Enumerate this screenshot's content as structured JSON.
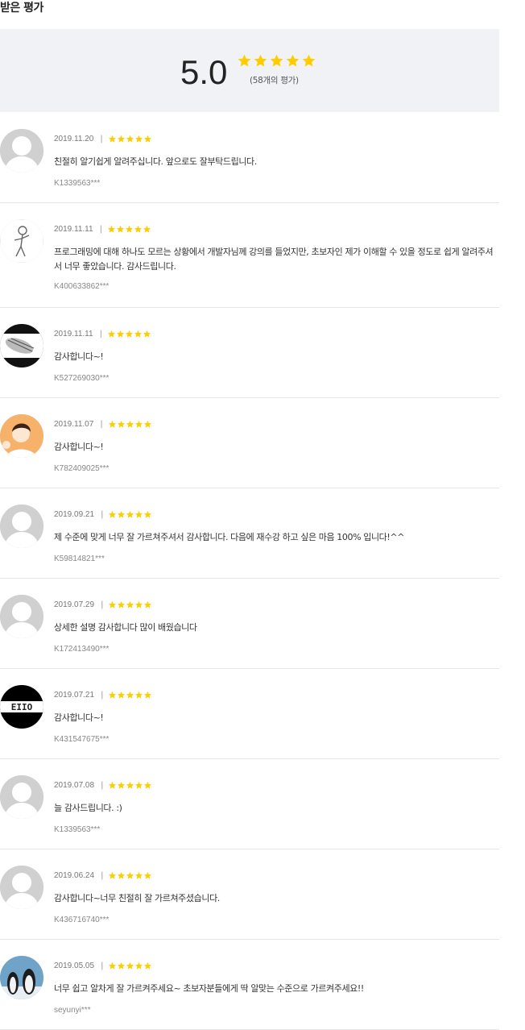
{
  "section_title": "받은 평가",
  "summary": {
    "score": "5.0",
    "stars": 5,
    "count_label": "(58개의 평가)"
  },
  "colors": {
    "star": "#ffcc00",
    "summary_bg": "#f1f2f6"
  },
  "reviews": [
    {
      "date": "2019.11.20",
      "rating": 5,
      "text": "친절히 알기쉽게 알려주십니다. 앞으로도 잘부탁드립니다.",
      "author": "K1339563***",
      "avatar": "default-avatar"
    },
    {
      "date": "2019.11.11",
      "rating": 5,
      "text": "프로그래밍에 대해 하나도 모르는 상황에서 개발자님께 강의를 들었지만, 초보자인 제가 이해할 수 있을 정도로 쉽게 알려주셔서 너무 좋았습니다. 감사드립니다.",
      "author": "K400633862***",
      "avatar": "sketch-avatar"
    },
    {
      "date": "2019.11.11",
      "rating": 5,
      "text": "감사합니다~!",
      "author": "K527269030***",
      "avatar": "fish-avatar"
    },
    {
      "date": "2019.11.07",
      "rating": 5,
      "text": "감사합니다~!",
      "author": "K782409025***",
      "avatar": "photo-avatar"
    },
    {
      "date": "2019.09.21",
      "rating": 5,
      "text": "제 수준에 맞게 너무 잘 가르쳐주셔서 감사합니다. 다음에 재수강 하고 싶은 마음 100% 입니다!^^",
      "author": "K59814821***",
      "avatar": "default-avatar"
    },
    {
      "date": "2019.07.29",
      "rating": 5,
      "text": "상세한 설명 감사합니다 많이 배웠습니다",
      "author": "K172413490***",
      "avatar": "default-avatar"
    },
    {
      "date": "2019.07.21",
      "rating": 5,
      "text": "감사합니다~!",
      "author": "K431547675***",
      "avatar": "logo-avatar"
    },
    {
      "date": "2019.07.08",
      "rating": 5,
      "text": "늘 감사드립니다. :)",
      "author": "K1339563***",
      "avatar": "default-avatar"
    },
    {
      "date": "2019.06.24",
      "rating": 5,
      "text": "감사합니다~너무 친절히 잘 가르쳐주셨습니다.",
      "author": "K436716740***",
      "avatar": "default-avatar"
    },
    {
      "date": "2019.05.05",
      "rating": 5,
      "text": "너무 쉽고 알차게 잘 가르켜주세요~ 초보자분들에게 딱 알맞는 수준으로 가르켜주세요!!",
      "author": "seyunyi***",
      "avatar": "penguin-avatar"
    }
  ]
}
